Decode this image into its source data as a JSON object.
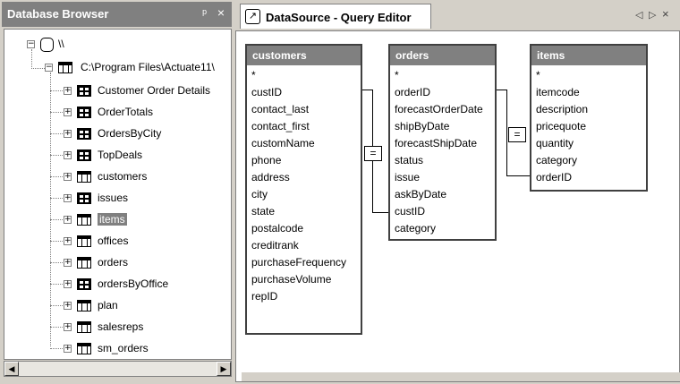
{
  "database_browser": {
    "title": "Database Browser",
    "pin": "ᵖ",
    "close": "×",
    "tree": {
      "root": "\\\\",
      "connection": "C:\\Program Files\\Actuate11\\",
      "items": [
        {
          "label": "Customer Order Details",
          "icon": "query-icon"
        },
        {
          "label": "OrderTotals",
          "icon": "query-icon"
        },
        {
          "label": "OrdersByCity",
          "icon": "query-icon"
        },
        {
          "label": "TopDeals",
          "icon": "query-icon"
        },
        {
          "label": "customers",
          "icon": "table-icon"
        },
        {
          "label": "issues",
          "icon": "query-icon"
        },
        {
          "label": "items",
          "icon": "table-icon",
          "selected": true
        },
        {
          "label": "offices",
          "icon": "table-icon"
        },
        {
          "label": "orders",
          "icon": "table-icon"
        },
        {
          "label": "ordersByOffice",
          "icon": "query-icon"
        },
        {
          "label": "plan",
          "icon": "table-icon"
        },
        {
          "label": "salesreps",
          "icon": "table-icon"
        },
        {
          "label": "sm_orders",
          "icon": "table-icon"
        }
      ]
    }
  },
  "query_editor": {
    "tab_title": "DataSource - Query Editor",
    "nav": {
      "left": "◁",
      "right": "▷",
      "close": "×"
    },
    "tables": [
      {
        "name": "customers",
        "fields": [
          "*",
          "custID",
          "contact_last",
          "contact_first",
          "customName",
          "phone",
          "address",
          "city",
          "state",
          "postalcode",
          "creditrank",
          "purchaseFrequency",
          "purchaseVolume",
          "repID"
        ]
      },
      {
        "name": "orders",
        "fields": [
          "*",
          "orderID",
          "forecastOrderDate",
          "shipByDate",
          "forecastShipDate",
          "status",
          "issue",
          "askByDate",
          "custID",
          "category"
        ]
      },
      {
        "name": "items",
        "fields": [
          "*",
          "itemcode",
          "description",
          "pricequote",
          "quantity",
          "category",
          "orderID"
        ]
      }
    ],
    "join_symbol": "="
  }
}
